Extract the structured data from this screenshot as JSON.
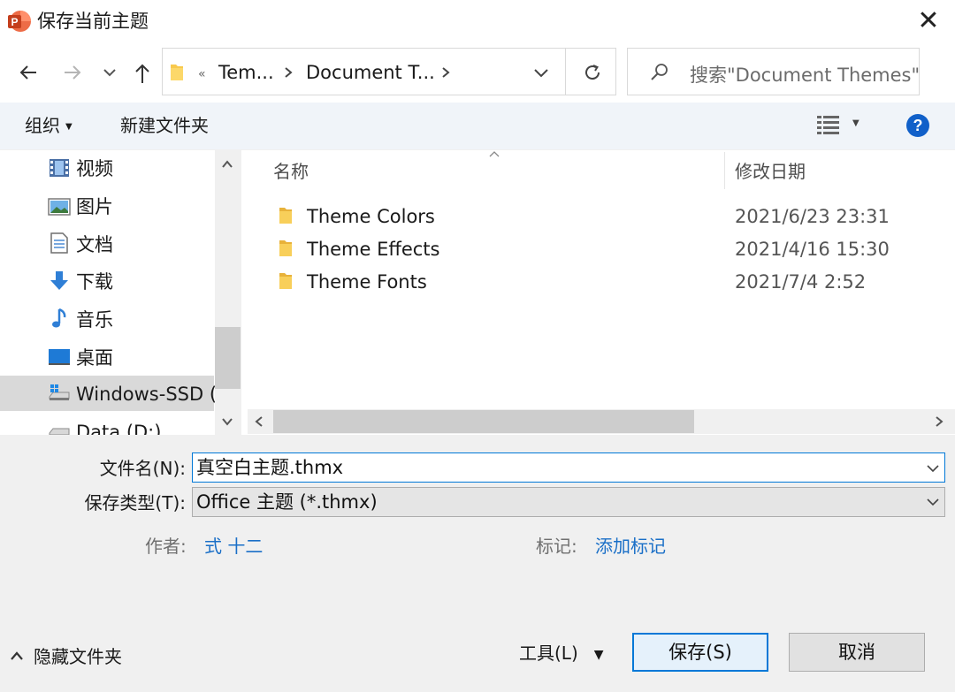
{
  "window": {
    "title": "保存当前主题",
    "app_icon_letter": "P"
  },
  "nav": {
    "breadcrumb_overflow": "«",
    "breadcrumbs": [
      "Tem...",
      "Document T..."
    ],
    "search_placeholder": "搜索\"Document Themes\""
  },
  "toolbar": {
    "organize_label": "组织",
    "new_folder_label": "新建文件夹"
  },
  "sidebar": {
    "items": [
      {
        "label": "视频",
        "icon": "video-icon"
      },
      {
        "label": "图片",
        "icon": "pictures-icon"
      },
      {
        "label": "文档",
        "icon": "documents-icon"
      },
      {
        "label": "下载",
        "icon": "download-icon"
      },
      {
        "label": "音乐",
        "icon": "music-icon"
      },
      {
        "label": "桌面",
        "icon": "desktop-icon"
      },
      {
        "label": "Windows-SSD (",
        "icon": "drive-icon",
        "selected": true
      },
      {
        "label": "Data (D:)",
        "icon": "drive-icon"
      }
    ]
  },
  "files": {
    "columns": {
      "name": "名称",
      "modified": "修改日期"
    },
    "rows": [
      {
        "name": "Theme Colors",
        "modified": "2021/6/23 23:31"
      },
      {
        "name": "Theme Effects",
        "modified": "2021/4/16 15:30"
      },
      {
        "name": "Theme Fonts",
        "modified": "2021/7/4 2:52"
      }
    ]
  },
  "form": {
    "filename_label": "文件名(N):",
    "filename_value": "真空白主题.thmx",
    "filetype_label": "保存类型(T):",
    "filetype_value": "Office 主题 (*.thmx)",
    "author_label": "作者:",
    "author_value": "式 十二",
    "tags_label": "标记:",
    "tags_value": "添加标记"
  },
  "footer": {
    "hide_folders_label": "隐藏文件夹",
    "tools_label": "工具(L)",
    "save_label": "保存(S)",
    "cancel_label": "取消"
  },
  "colors": {
    "accent": "#0078d7",
    "link": "#1a6fc7",
    "selection": "#d9d9d9",
    "folder": "#f8c94d",
    "app_icon": "#d24726"
  }
}
